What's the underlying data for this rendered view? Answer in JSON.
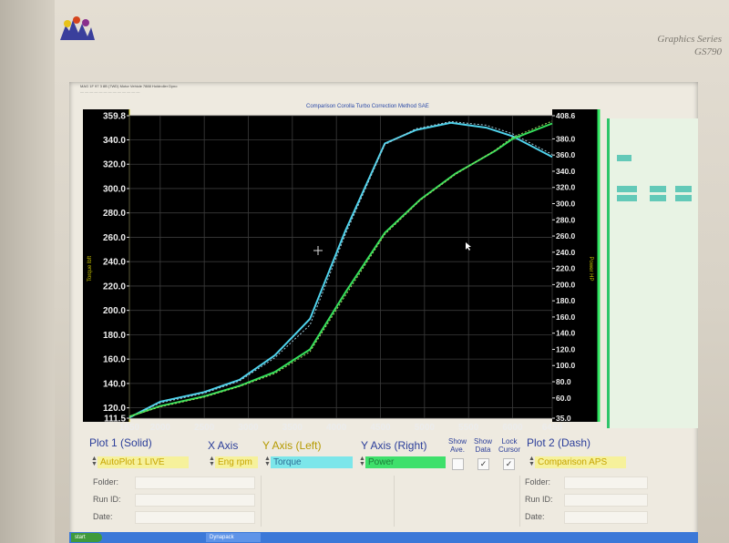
{
  "monitor": {
    "brand_line1": "Graphics Series",
    "brand_line2": "GS790"
  },
  "app": {
    "top_line": "MAG 1F 97 3 8B (7WD) Motor Vehicle 7888 Holdroller Dyno",
    "comparison_line": "Comparison Corolla Turbo     Correction Method SAE"
  },
  "chart_data": {
    "type": "line",
    "xlabel": "",
    "ylabel_left": "Torque lbft",
    "ylabel_right": "Power HP",
    "x_ticks": [
      "1650",
      "2000",
      "2500",
      "3000",
      "3500",
      "4000",
      "4500",
      "5000",
      "5500",
      "6000",
      "6450"
    ],
    "xlim": [
      1650,
      6450
    ],
    "y_left_ticks": [
      "359.8",
      "340.0",
      "320.0",
      "300.0",
      "280.0",
      "260.0",
      "240.0",
      "220.0",
      "200.0",
      "180.0",
      "160.0",
      "140.0",
      "120.0",
      "111.5"
    ],
    "ylim_left": [
      111.5,
      359.8
    ],
    "y_right_ticks": [
      "408.6",
      "380.0",
      "360.0",
      "340.0",
      "320.0",
      "300.0",
      "280.0",
      "260.0",
      "240.0",
      "220.0",
      "200.0",
      "180.0",
      "160.0",
      "140.0",
      "120.0",
      "100.0",
      "80.0",
      "60.0",
      "35.0"
    ],
    "ylim_right": [
      35.0,
      408.6
    ],
    "grid": true,
    "series": [
      {
        "name": "Torque",
        "axis": "left",
        "color": "#4fd3ec",
        "style": "solid",
        "x": [
          1650,
          2000,
          2500,
          2900,
          3300,
          3700,
          4100,
          4550,
          4900,
          5300,
          5700,
          6000,
          6450
        ],
        "values": [
          112,
          125,
          133,
          143,
          163,
          193,
          265,
          337,
          348,
          354,
          350,
          343,
          326
        ]
      },
      {
        "name": "Torque",
        "axis": "left",
        "color": "#9ec8d8",
        "style": "dash",
        "x": [
          1650,
          2000,
          2500,
          2900,
          3300,
          3700,
          4100,
          4550,
          4900,
          5300,
          5700,
          6000,
          6450
        ],
        "values": [
          112,
          124,
          132,
          142,
          161,
          188,
          262,
          336,
          349,
          355,
          352,
          345,
          328
        ]
      },
      {
        "name": "Power",
        "axis": "right",
        "color": "#35e05d",
        "style": "solid",
        "x": [
          1650,
          2000,
          2500,
          2900,
          3300,
          3700,
          4100,
          4550,
          4950,
          5350,
          5800,
          6000,
          6450
        ],
        "values": [
          37,
          50,
          62,
          75,
          92,
          120,
          190,
          264,
          305,
          337,
          365,
          380,
          399
        ]
      },
      {
        "name": "Power",
        "axis": "right",
        "color": "#a3d860",
        "style": "dash",
        "x": [
          1650,
          2000,
          2500,
          2900,
          3300,
          3700,
          4100,
          4550,
          4950,
          5350,
          5800,
          6000,
          6450
        ],
        "values": [
          37,
          49,
          61,
          74,
          90,
          117,
          186,
          262,
          304,
          336,
          366,
          382,
          402
        ]
      }
    ]
  },
  "controls": {
    "plot1_label": "Plot 1 (Solid)",
    "xaxis_label": "X Axis",
    "yleft_label": "Y Axis (Left)",
    "yright_label": "Y Axis (Right)",
    "show_ave": "Show Ave.",
    "show_data": "Show Data",
    "lock_cursor": "Lock Cursor",
    "plot2_label": "Plot 2 (Dash)",
    "plot1_value": "AutoPlot 1 LIVE",
    "xaxis_value": "Eng rpm",
    "yleft_value": "Torque",
    "yright_value": "Power",
    "plot2_value": "Comparison APS",
    "show_data_checked": "✓",
    "lock_cursor_checked": "✓"
  },
  "info": {
    "folder_label": "Folder:",
    "runid_label": "Run ID:",
    "date_label": "Date:",
    "folder_label2": "Folder:",
    "runid_label2": "Run ID:",
    "date_label2": "Date:"
  },
  "taskbar": {
    "start_label": "start",
    "task_label": "Dynapack"
  }
}
